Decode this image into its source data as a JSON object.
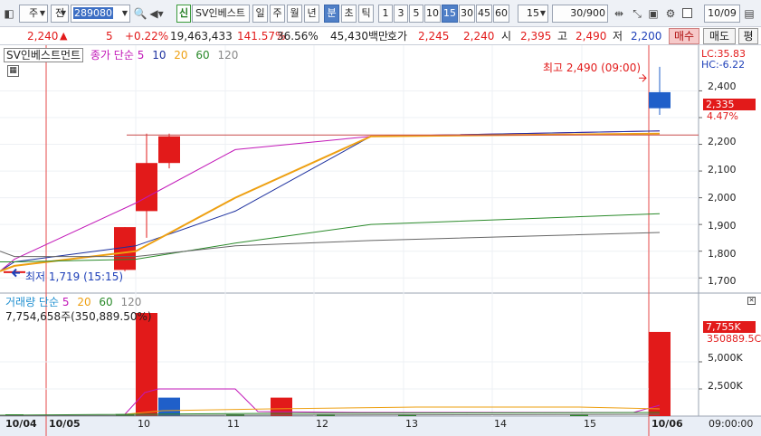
{
  "toolbar": {
    "market": "주",
    "period_type": "전",
    "code": "289080",
    "badge": "신",
    "stock_name": "SV인베스트",
    "period_buttons": [
      "일",
      "주",
      "월",
      "년",
      "분",
      "초",
      "틱"
    ],
    "active_period": "분",
    "minute_buttons": [
      "1",
      "3",
      "5",
      "10",
      "15",
      "30",
      "45",
      "60"
    ],
    "active_minute": "15",
    "minute_select": "15",
    "count_value": "30",
    "count_max": "/900",
    "date_value": "10/09"
  },
  "quote": {
    "price": "2,240",
    "change_arrow": "▲",
    "change": "5",
    "change_pct": "+0.22%",
    "volume": "19,463,433",
    "volume_ratio": "141.57%",
    "turnover_ratio": "36.56%",
    "amount": "45,430백만",
    "ask_label": "호가",
    "ask": "2,245",
    "bid": "2,240",
    "open_label": "시",
    "open": "2,395",
    "high_label": "고",
    "high": "2,490",
    "low_label": "저",
    "low": "2,200",
    "buy_btn": "매수",
    "sell_btn": "매도",
    "more_btn": "평"
  },
  "price_panel": {
    "title": "SV인베스트먼트",
    "ma_label": "종가 단순",
    "ma_periods": [
      "5",
      "10",
      "20",
      "60",
      "120"
    ],
    "lc": "LC:35.83",
    "hc": "HC:-6.22",
    "high_annot": "최고 2,490 (09:00)",
    "low_annot": "최저 1,719 (15:15)",
    "current_tag": "2,335",
    "current_pct": "4.47%",
    "y_ticks": [
      "2,400",
      "2,300",
      "2,200",
      "2,100",
      "2,000",
      "1,900",
      "1,800",
      "1,700"
    ]
  },
  "volume_panel": {
    "title": "거래량 단순",
    "ma_periods": [
      "5",
      "20",
      "60",
      "120"
    ],
    "info": "7,754,658주(350,889.50%)",
    "current_tag": "7,755K",
    "current_sub": "350889.5C",
    "y_ticks": [
      "5,000K",
      "2,500K"
    ]
  },
  "x_axis": {
    "labels": [
      "10/04",
      "10/05",
      "10",
      "11",
      "12",
      "13",
      "14",
      "15",
      "10/06"
    ],
    "time_label": "09:00:00"
  },
  "colors": {
    "up": "#e21a1a",
    "down": "#1f5fc9",
    "ma5": "#c218b8",
    "ma10": "#1b2f9e",
    "ma20": "#eea012",
    "ma60": "#2a8a2a",
    "ma120": "#666666"
  },
  "chart_data": [
    {
      "type": "candlestick",
      "title": "SV인베스트먼트",
      "x": [
        "10/04",
        "10/05 09:00",
        "10/05 10:00",
        "10/05 10:15",
        "10/05 10:30",
        "10/06 09:00"
      ],
      "open": [
        1719,
        1730,
        1950,
        2130,
        2130,
        2395
      ],
      "high": [
        1730,
        1890,
        2240,
        2240,
        2230,
        2490
      ],
      "low": [
        1715,
        1725,
        1850,
        2110,
        2125,
        2310
      ],
      "close": [
        1725,
        1890,
        2130,
        2230,
        2240,
        2335
      ],
      "ylim": [
        1650,
        2520
      ],
      "y_ticks": [
        1700,
        1800,
        1900,
        2000,
        2100,
        2200,
        2300,
        2400
      ],
      "series": [
        {
          "name": "5",
          "values": [
            1725,
            1770,
            1980,
            2180,
            2230,
            2250
          ]
        },
        {
          "name": "10",
          "values": [
            1725,
            1760,
            1820,
            1950,
            2230,
            2250
          ]
        },
        {
          "name": "20",
          "values": [
            1725,
            1745,
            1800,
            2000,
            2230,
            2240
          ]
        },
        {
          "name": "60",
          "values": [
            1760,
            1760,
            1770,
            1830,
            1900,
            1940
          ]
        },
        {
          "name": "120",
          "values": [
            1800,
            1780,
            1780,
            1820,
            1840,
            1870
          ]
        }
      ]
    },
    {
      "type": "bar",
      "title": "거래량 단순",
      "categories": [
        "10/05 10:00",
        "10/05 10:15",
        "10/05 11:30",
        "10/06 09:00"
      ],
      "values": [
        9500,
        1700,
        1700,
        7755
      ],
      "ylim": [
        0,
        10000
      ],
      "y_ticks": [
        2500,
        5000
      ]
    }
  ]
}
